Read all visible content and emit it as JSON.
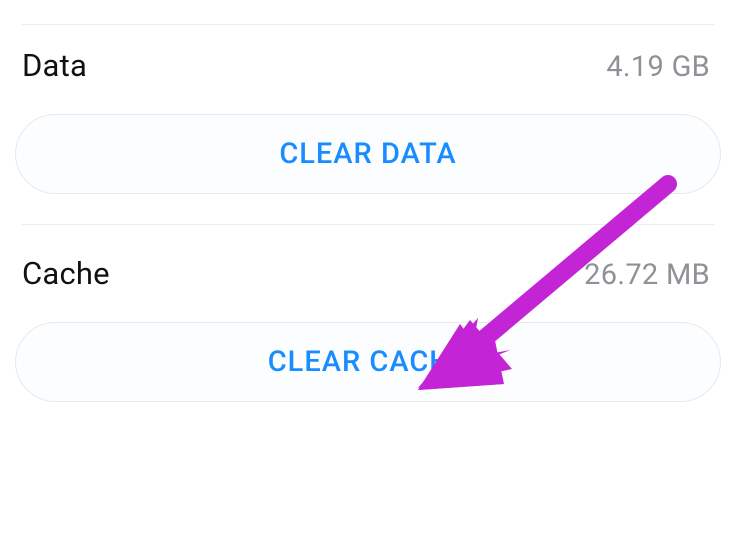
{
  "storage": {
    "data": {
      "label": "Data",
      "value": "4.19 GB",
      "clear_btn_label": "CLEAR DATA"
    },
    "cache": {
      "label": "Cache",
      "value": "26.72 MB",
      "clear_btn_label": "CLEAR CACHE"
    }
  },
  "colors": {
    "accent": "#198cff",
    "arrow": "#c224d6"
  }
}
